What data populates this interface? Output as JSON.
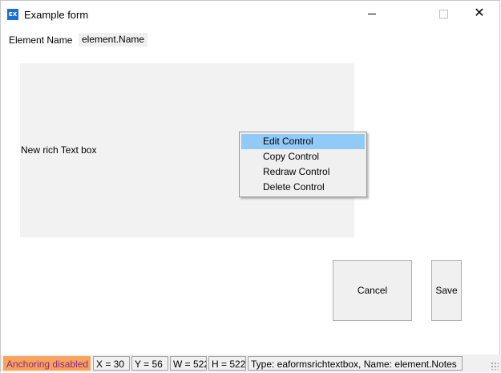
{
  "window": {
    "title": "Example form",
    "icon_label": "EX",
    "close_glyph": "✕"
  },
  "form": {
    "element_name_label": "Element Name",
    "element_name_value": "element.Name",
    "richbox_label": "New rich Text box",
    "cancel_label": "Cancel",
    "save_label": "Save"
  },
  "context_menu": {
    "items": [
      {
        "label": "Edit Control",
        "highlighted": true
      },
      {
        "label": "Copy Control"
      },
      {
        "label": "Redraw Control"
      },
      {
        "label": "Delete Control"
      }
    ]
  },
  "statusbar": {
    "anchoring": "Anchoring disabled",
    "x": "X = 30",
    "y": "Y = 56",
    "w": "W = 522",
    "h": "H = 522",
    "type": "Type: eaformsrichtextbox, Name: element.Notes"
  },
  "colors": {
    "menu_highlight": "#91c9f7",
    "anchoring_bg": "#f7a35c",
    "app_icon": "#1f6fd1"
  }
}
